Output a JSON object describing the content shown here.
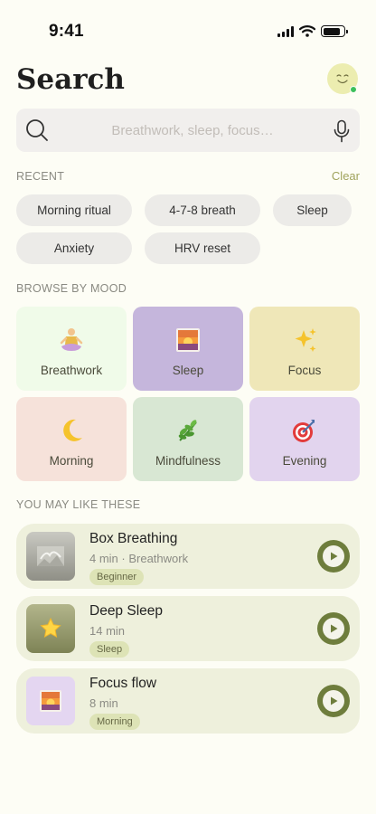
{
  "status_bar": {
    "time": "9:41",
    "battery_level": 0.85
  },
  "header": {
    "title": "Search",
    "avatar_icon": "smiley-face-icon",
    "online": true
  },
  "search": {
    "placeholder": "Breathwork, sleep, focus…",
    "value": ""
  },
  "recent": {
    "label": "RECENT",
    "clear_label": "Clear",
    "chips": [
      "Morning ritual",
      "4-7-8 breath",
      "Sleep",
      "Anxiety",
      "HRV reset"
    ]
  },
  "browse": {
    "label": "BROWSE BY MOOD",
    "moods": [
      {
        "label": "Breathwork",
        "icon": "meditation-icon",
        "color": "#f0fbe9"
      },
      {
        "label": "Sleep",
        "icon": "sunset-icon",
        "color": "#c5b6dc"
      },
      {
        "label": "Focus",
        "icon": "sparkles-icon",
        "color": "#efe7b8"
      },
      {
        "label": "Morning",
        "icon": "crescent-moon-icon",
        "color": "#f6e2da"
      },
      {
        "label": "Mindfulness",
        "icon": "herb-icon",
        "color": "#d8e7d3"
      },
      {
        "label": "Evening",
        "icon": "target-icon",
        "color": "#e2d4ee"
      }
    ]
  },
  "recommendations": {
    "label": "YOU MAY LIKE THESE",
    "items": [
      {
        "title": "Box Breathing",
        "meta": "4 min · Breathwork",
        "tag": "Beginner",
        "thumb_icon": "misty-landscape-icon"
      },
      {
        "title": "Deep Sleep",
        "meta": "14 min",
        "tag": "Sleep",
        "thumb_icon": "star-icon"
      },
      {
        "title": "Focus flow",
        "meta": "8 min",
        "tag": "Morning",
        "thumb_icon": "sunset-icon"
      }
    ]
  },
  "colors": {
    "accent": "#6e7d3c",
    "background": "#fdfdf5",
    "chip": "#ecebe8",
    "card": "#eef0dc",
    "tag": "#dde3b6"
  }
}
